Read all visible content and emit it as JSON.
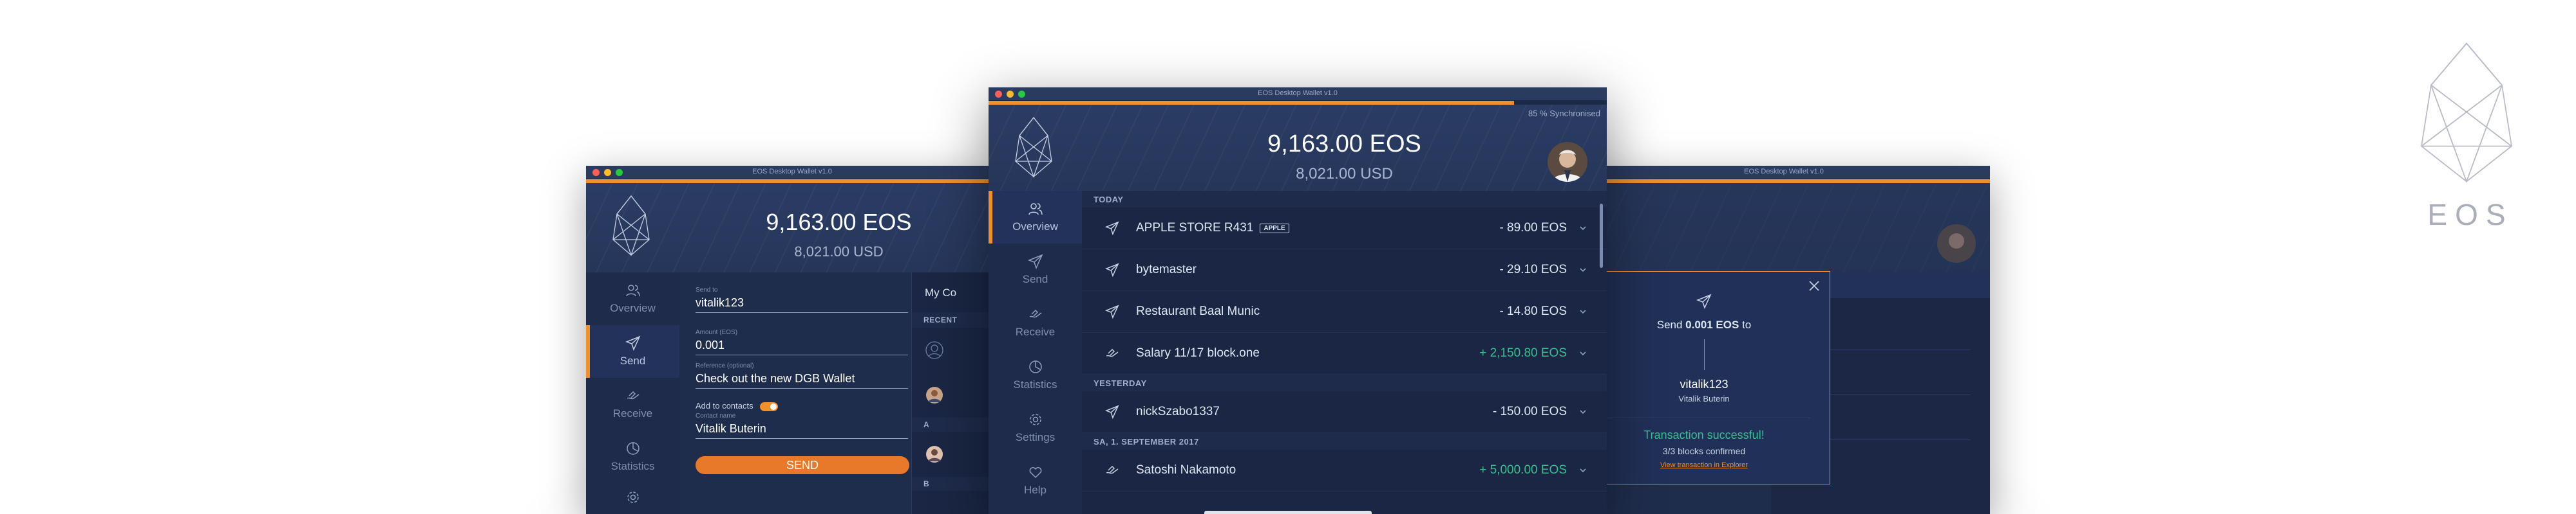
{
  "left_window": {
    "title": "EOS Desktop Wallet v1.0",
    "balance": "9,163.00 EOS",
    "fiat": "8,021.00 USD",
    "nav": [
      "Overview",
      "Send",
      "Receive",
      "Statistics"
    ],
    "form": {
      "to_label": "Send to",
      "to_value": "vitalik123",
      "amount_label": "Amount (EOS)",
      "amount_value": "0.001",
      "ref_label": "Reference (optional)",
      "ref_value": "Check out the new DGB Wallet",
      "add_contact": "Add to contacts",
      "contact_label": "Contact name",
      "contact_value": "Vitalik Buterin",
      "send_button": "SEND"
    },
    "contacts": {
      "title": "My Co",
      "recent": "RECENT",
      "letter_a": "A",
      "letter_b": "B"
    }
  },
  "center_window": {
    "title": "EOS Desktop Wallet v1.0",
    "sync": "85 % Synchronised",
    "sync_progress": 0.85,
    "balance": "9,163.00 EOS",
    "fiat": "8,021.00 USD",
    "nav": [
      "Overview",
      "Send",
      "Receive",
      "Statistics",
      "Settings",
      "Help"
    ],
    "sections": [
      {
        "label": "TODAY",
        "items": [
          {
            "name": "APPLE STORE R431",
            "tag": "APPLE",
            "amount": "- 89.00 EOS",
            "dir": "sent"
          },
          {
            "name": "bytemaster",
            "tag": "",
            "amount": "- 29.10 EOS",
            "dir": "sent"
          },
          {
            "name": "Restaurant Baal Munic",
            "tag": "",
            "amount": "- 14.80 EOS",
            "dir": "sent"
          },
          {
            "name": "Salary 11/17 block.one",
            "tag": "",
            "amount": "+ 2,150.80 EOS",
            "dir": "received"
          }
        ]
      },
      {
        "label": "YESTERDAY",
        "items": [
          {
            "name": "nickSzabo1337",
            "tag": "",
            "amount": "- 150.00 EOS",
            "dir": "sent"
          }
        ]
      },
      {
        "label": "SA, 1. SEPTEMBER 2017",
        "items": [
          {
            "name": "Satoshi Nakamoto",
            "tag": "",
            "amount": "+ 5,000.00 EOS",
            "dir": "received"
          }
        ]
      }
    ]
  },
  "right_window": {
    "title": "EOS Desktop Wallet v1.0",
    "modal": {
      "send_prefix": "Send",
      "send_amount": "0.001 EOS",
      "send_suffix": "to",
      "recipient": "vitalik123",
      "recipient_name": "Vitalik Buterin",
      "success": "Transaction successful!",
      "blocks": "3/3 blocks confirmed",
      "link": "View transaction in Explorer"
    }
  },
  "brand": {
    "text": "EOS"
  },
  "colors": {
    "accent": "#f0902a",
    "positive": "#36c08f",
    "panel": "#223151"
  }
}
